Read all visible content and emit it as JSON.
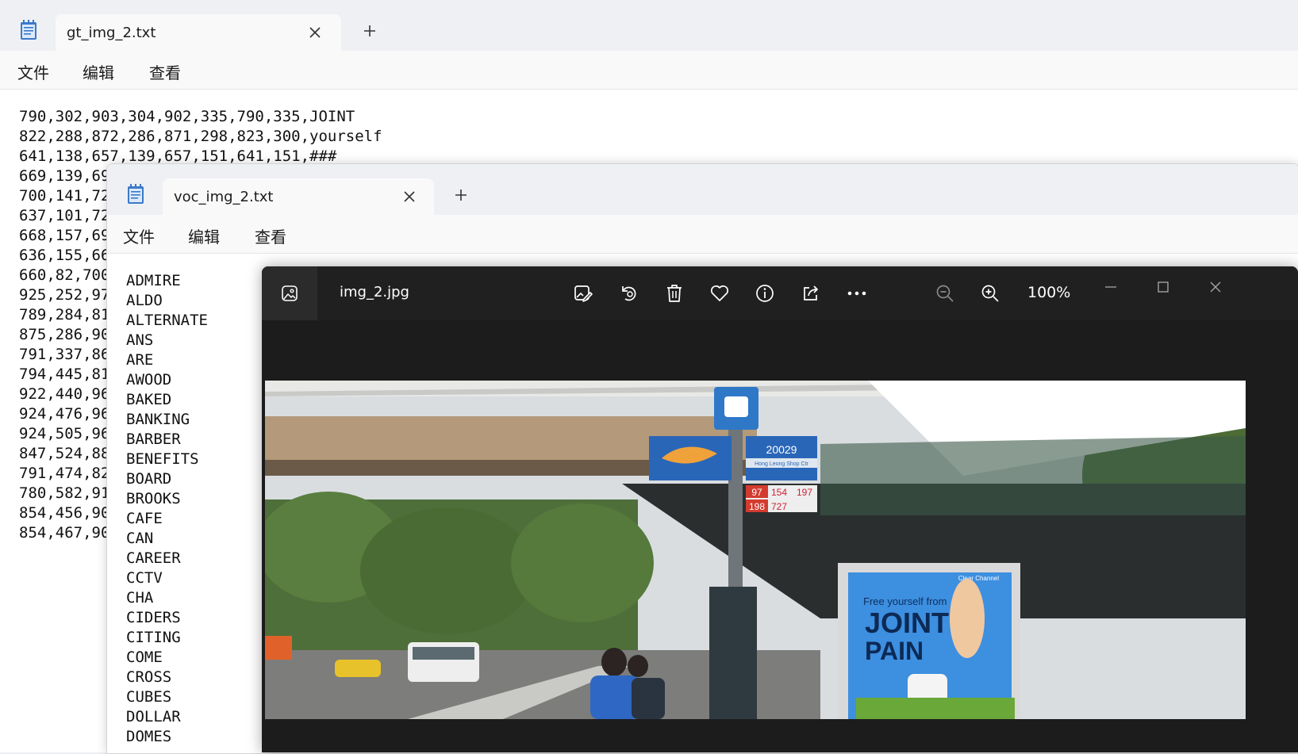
{
  "gt_window": {
    "tab_title": "gt_img_2.txt",
    "menu": [
      "文件",
      "编辑",
      "查看"
    ],
    "lines": [
      "790,302,903,304,902,335,790,335,JOINT",
      "822,288,872,286,871,298,823,300,yourself",
      "641,138,657,139,657,151,641,151,###",
      "669,139,69",
      "700,141,72",
      "637,101,72",
      "668,157,69",
      "636,155,66",
      "660,82,700",
      "925,252,97",
      "789,284,81",
      "875,286,90",
      "791,337,86",
      "794,445,81",
      "922,440,96",
      "924,476,96",
      "924,505,96",
      "847,524,88",
      "791,474,82",
      "780,582,91",
      "854,456,90",
      "854,467,90"
    ]
  },
  "voc_window": {
    "tab_title": "voc_img_2.txt",
    "menu": [
      "文件",
      "编辑",
      "查看"
    ],
    "lines": [
      "ADMIRE",
      "ALDO",
      "ALTERNATE",
      "ANS",
      "ARE",
      "AWOOD",
      "BAKED",
      "BANKING",
      "BARBER",
      "BENEFITS",
      "BOARD",
      "BROOKS",
      "CAFE",
      "CAN",
      "CAREER",
      "CCTV",
      "CHA",
      "CIDERS",
      "CITING",
      "COME",
      "CROSS",
      "CUBES",
      "DOLLAR",
      "DOMES"
    ]
  },
  "photos_window": {
    "file_name": "img_2.jpg",
    "zoom": "100%",
    "icons": [
      "edit-image-icon",
      "rotate-icon",
      "delete-icon",
      "favorite-icon",
      "info-icon",
      "share-icon",
      "more-icon",
      "zoom-out-icon",
      "zoom-in-icon"
    ],
    "image": {
      "bus_stop_code": "20029",
      "bus_stop_name": "Hong Leong Shop Ctr",
      "routes": [
        "97",
        "154",
        "197",
        "198",
        "727"
      ],
      "ad_small": "Free yourself from",
      "ad_big_1": "JOINT",
      "ad_big_2": "PAIN",
      "ad_brand": "Clear Channel"
    }
  }
}
